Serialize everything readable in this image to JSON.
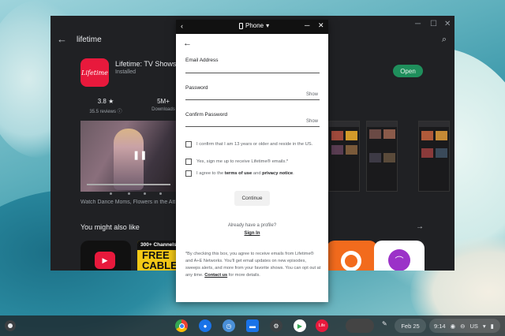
{
  "store": {
    "search_query": "lifetime",
    "app_name": "Lifetime: TV Shows & M",
    "app_status": "Installed",
    "app_icon_text": "Lifetime",
    "open_label": "Open",
    "rating_value": "3.8 ★",
    "rating_label": "35.5 reviews ⓘ",
    "downloads_value": "5M+",
    "downloads_label": "Downloads",
    "description": "Watch Dance Moms, Flowers in the Attic",
    "section_title": "You might also like",
    "rec_tile2_band": "300+ Channels",
    "rec_tile2_big": "FREE\nCABLE"
  },
  "dialog": {
    "device_label": "Phone",
    "email_label": "Email Address",
    "password_label": "Password",
    "password_show": "Show",
    "confirm_label": "Confirm Password",
    "confirm_show": "Show",
    "check1": "I confirm that I am 13 years or older and reside in the US.",
    "check2": "Yes, sign me up to receive Lifetime® emails.*",
    "check3_prefix": "I agree to the ",
    "check3_terms": "terms of use",
    "check3_mid": " and ",
    "check3_privacy": "privacy notice",
    "check3_suffix": ".",
    "continue_label": "Continue",
    "already": "Already have a profile?",
    "signin": "Sign In",
    "legal_text": "*By checking this box, you agree to receive emails from Lifetime® and A+E Networks. You'll get email updates on new episodes, sweeps alerts, and more from your favorite shows. You can opt out at any time. ",
    "legal_contact": "Contact us",
    "legal_suffix": " for more details."
  },
  "shelf": {
    "date": "Feb 25",
    "time": "9:14",
    "locale": "US"
  },
  "colors": {
    "store_bg": "#202124",
    "open_button": "#1f8f5c",
    "lifetime_red": "#e8193c",
    "dialog_bg": "#ffffff"
  }
}
